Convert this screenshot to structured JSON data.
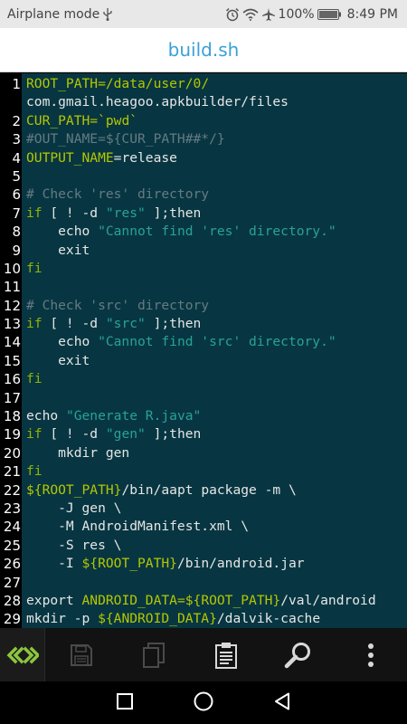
{
  "status_bar": {
    "mode_text": "Airplane mode",
    "battery": "100%",
    "time": "8:49 PM",
    "icons": [
      "usb-icon",
      "alarm-icon",
      "wifi-icon",
      "airplane-icon",
      "battery-icon"
    ]
  },
  "title_bar": {
    "title": "build.sh"
  },
  "editor": {
    "line_numbers": [
      "1",
      "",
      "2",
      "3",
      "4",
      "5",
      "6",
      "7",
      "8",
      "9",
      "10",
      "11",
      "12",
      "13",
      "14",
      "15",
      "16",
      "17",
      "18",
      "19",
      "20",
      "21",
      "22",
      "23",
      "24",
      "25",
      "26",
      "27",
      "28",
      "29"
    ],
    "lines": [
      [
        {
          "t": "ROOT_PATH",
          "c": "var"
        },
        {
          "t": "=/data/user/",
          "c": "var"
        },
        {
          "t": "0",
          "c": "var"
        },
        {
          "t": "/",
          "c": "var"
        }
      ],
      [
        {
          "t": "com.gmail.heagoo.apkbuilder/files",
          "c": "text"
        }
      ],
      [
        {
          "t": "CUR_PATH",
          "c": "var"
        },
        {
          "t": "=`pwd`",
          "c": "var"
        }
      ],
      [
        {
          "t": "#OUT_NAME=${CUR_PATH##*/}",
          "c": "com"
        }
      ],
      [
        {
          "t": "OUTPUT_NAME",
          "c": "var"
        },
        {
          "t": "=release",
          "c": "text"
        }
      ],
      [
        {
          "t": "",
          "c": "text"
        }
      ],
      [
        {
          "t": "# Check 'res' directory",
          "c": "com"
        }
      ],
      [
        {
          "t": "if",
          "c": "kw"
        },
        {
          "t": " [ ! -d ",
          "c": "text"
        },
        {
          "t": "\"res\"",
          "c": "str"
        },
        {
          "t": " ];then",
          "c": "text"
        }
      ],
      [
        {
          "t": "    echo ",
          "c": "text"
        },
        {
          "t": "\"Cannot find 'res' directory.\"",
          "c": "str"
        }
      ],
      [
        {
          "t": "    exit",
          "c": "text"
        }
      ],
      [
        {
          "t": "fi",
          "c": "kw"
        }
      ],
      [
        {
          "t": "",
          "c": "text"
        }
      ],
      [
        {
          "t": "# Check 'src' directory",
          "c": "com"
        }
      ],
      [
        {
          "t": "if",
          "c": "kw"
        },
        {
          "t": " [ ! -d ",
          "c": "text"
        },
        {
          "t": "\"src\"",
          "c": "str"
        },
        {
          "t": " ];then",
          "c": "text"
        }
      ],
      [
        {
          "t": "    echo ",
          "c": "text"
        },
        {
          "t": "\"Cannot find 'src' directory.\"",
          "c": "str"
        }
      ],
      [
        {
          "t": "    exit",
          "c": "text"
        }
      ],
      [
        {
          "t": "fi",
          "c": "kw"
        }
      ],
      [
        {
          "t": "",
          "c": "text"
        }
      ],
      [
        {
          "t": "echo ",
          "c": "text"
        },
        {
          "t": "\"Generate R.java\"",
          "c": "str"
        }
      ],
      [
        {
          "t": "if",
          "c": "kw"
        },
        {
          "t": " [ ! -d ",
          "c": "text"
        },
        {
          "t": "\"gen\"",
          "c": "str"
        },
        {
          "t": " ];then",
          "c": "text"
        }
      ],
      [
        {
          "t": "    mkdir gen",
          "c": "text"
        }
      ],
      [
        {
          "t": "fi",
          "c": "kw"
        }
      ],
      [
        {
          "t": "${",
          "c": "var"
        },
        {
          "t": "ROOT_PATH",
          "c": "var"
        },
        {
          "t": "}",
          "c": "var"
        },
        {
          "t": "/bin/aapt package -m \\",
          "c": "text"
        }
      ],
      [
        {
          "t": "    -J gen \\",
          "c": "text"
        }
      ],
      [
        {
          "t": "    -M AndroidManifest.xml \\",
          "c": "text"
        }
      ],
      [
        {
          "t": "    -S res \\",
          "c": "text"
        }
      ],
      [
        {
          "t": "    -I ",
          "c": "text"
        },
        {
          "t": "${",
          "c": "var"
        },
        {
          "t": "ROOT_PATH",
          "c": "var"
        },
        {
          "t": "}",
          "c": "var"
        },
        {
          "t": "/bin/android.jar",
          "c": "text"
        }
      ],
      [
        {
          "t": "",
          "c": "text"
        }
      ],
      [
        {
          "t": "export ",
          "c": "text"
        },
        {
          "t": "ANDROID_DATA",
          "c": "var"
        },
        {
          "t": "=${",
          "c": "var"
        },
        {
          "t": "ROOT_PATH",
          "c": "var"
        },
        {
          "t": "}",
          "c": "var"
        },
        {
          "t": "/val/android",
          "c": "text"
        }
      ],
      [
        {
          "t": "mkdir -p ",
          "c": "text"
        },
        {
          "t": "${",
          "c": "var"
        },
        {
          "t": "ANDROID_DATA",
          "c": "var"
        },
        {
          "t": "}",
          "c": "var"
        },
        {
          "t": "/dalvik-cache",
          "c": "text"
        }
      ]
    ]
  },
  "toolbar": {
    "buttons": [
      {
        "name": "expand-arrows-icon",
        "enabled": true
      },
      {
        "name": "save-icon",
        "enabled": false
      },
      {
        "name": "copy-icon",
        "enabled": false
      },
      {
        "name": "clipboard-icon",
        "enabled": true
      },
      {
        "name": "search-icon",
        "enabled": true
      },
      {
        "name": "more-vert-icon",
        "enabled": true
      }
    ]
  },
  "colors": {
    "editor_bg": "#073642",
    "gutter_bg": "#000000",
    "title_color": "#3aa0d8",
    "keyword": "#95b400",
    "string": "#2aa198",
    "comment": "#657b83",
    "accent_green": "#8dc63f"
  }
}
